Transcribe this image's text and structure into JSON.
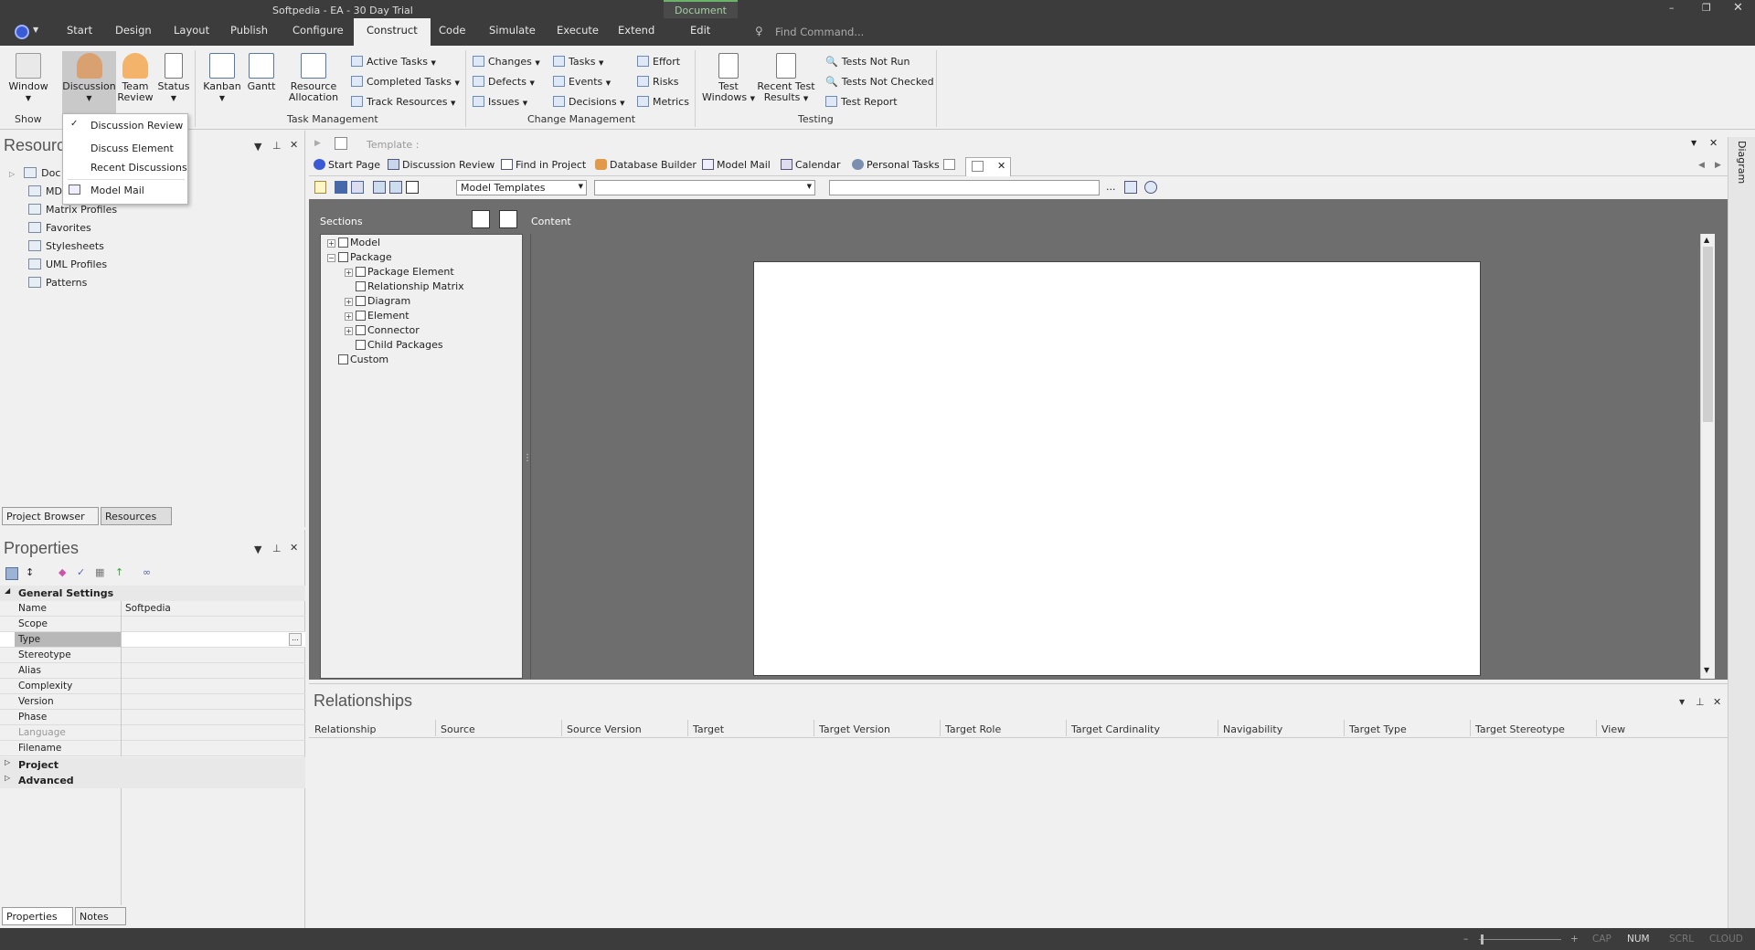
{
  "window": {
    "title": "Softpedia - EA - 30 Day Trial",
    "context_tab": "Document",
    "accent": "#6bb36b"
  },
  "menu": {
    "items": [
      "Start",
      "Design",
      "Layout",
      "Publish",
      "Configure",
      "Construct",
      "Code",
      "Simulate",
      "Execute",
      "Extend",
      "Edit"
    ],
    "active": "Construct",
    "find_placeholder": "Find Command..."
  },
  "ribbon": {
    "window": "Window",
    "discussion": "Discussion",
    "team": "Team",
    "review": "Review",
    "status": "Status",
    "kanban": "Kanban",
    "gantt": "Gantt",
    "resource": "Resource",
    "allocation": "Allocation",
    "active_tasks": "Active Tasks",
    "completed_tasks": "Completed Tasks",
    "track_resources": "Track Resources",
    "changes": "Changes",
    "defects": "Defects",
    "issues": "Issues",
    "tasks": "Tasks",
    "events": "Events",
    "decisions": "Decisions",
    "effort": "Effort",
    "risks": "Risks",
    "metrics": "Metrics",
    "test": "Test",
    "windows": "Windows",
    "recent_test": "Recent Test",
    "results": "Results",
    "tests_not_run": "Tests Not Run",
    "tests_not_checked": "Tests Not Checked",
    "test_report": "Test Report",
    "group_show": "Show",
    "group_task": "Task Management",
    "group_change": "Change Management",
    "group_testing": "Testing"
  },
  "dropdown": {
    "items": [
      "Discussion Review",
      "Discuss Element",
      "Recent Discussions",
      "Model Mail"
    ]
  },
  "resources": {
    "title": "Resource",
    "items": [
      "Doc",
      "MD",
      "Matrix Profiles",
      "Favorites",
      "Stylesheets",
      "UML Profiles",
      "Patterns"
    ],
    "tabs": [
      "Project Browser",
      "Resources"
    ]
  },
  "properties": {
    "title": "Properties",
    "section": "General Settings",
    "rows": [
      {
        "k": "Name",
        "v": "Softpedia"
      },
      {
        "k": "Scope",
        "v": ""
      },
      {
        "k": "Type",
        "v": ""
      },
      {
        "k": "Stereotype",
        "v": ""
      },
      {
        "k": "Alias",
        "v": ""
      },
      {
        "k": "Complexity",
        "v": ""
      },
      {
        "k": "Version",
        "v": ""
      },
      {
        "k": "Phase",
        "v": ""
      },
      {
        "k": "Language",
        "v": ""
      },
      {
        "k": "Filename",
        "v": ""
      }
    ],
    "groups": [
      "Project",
      "Advanced"
    ],
    "tabs": [
      "Properties",
      "Notes"
    ]
  },
  "template_bar": {
    "label": "Template :"
  },
  "doc_tabs": [
    "Start Page",
    "Discussion Review",
    "Find in Project",
    "Database Builder",
    "Model Mail",
    "Calendar",
    "Personal Tasks"
  ],
  "toolbar": {
    "template_select": "Model Templates",
    "ellipsis": "..."
  },
  "editor": {
    "sections_label": "Sections",
    "content_label": "Content",
    "tree": [
      {
        "label": "Model",
        "level": 0,
        "exp": "+"
      },
      {
        "label": "Package",
        "level": 0,
        "exp": "-"
      },
      {
        "label": "Package Element",
        "level": 1,
        "exp": "+"
      },
      {
        "label": "Relationship Matrix",
        "level": 1,
        "exp": ""
      },
      {
        "label": "Diagram",
        "level": 1,
        "exp": "+"
      },
      {
        "label": "Element",
        "level": 1,
        "exp": "+"
      },
      {
        "label": "Connector",
        "level": 1,
        "exp": "+"
      },
      {
        "label": "Child Packages",
        "level": 1,
        "exp": ""
      },
      {
        "label": "Custom",
        "level": 0,
        "exp": ""
      }
    ]
  },
  "relationships": {
    "title": "Relationships",
    "columns": [
      "Relationship",
      "Source",
      "Source Version",
      "Target",
      "Target Version",
      "Target Role",
      "Target Cardinality",
      "Navigability",
      "Target Type",
      "Target Stereotype",
      "View"
    ]
  },
  "side_tab": "Diagram",
  "statusbar": {
    "cap": "CAP",
    "num": "NUM",
    "scrl": "SCRL",
    "cloud": "CLOUD"
  }
}
